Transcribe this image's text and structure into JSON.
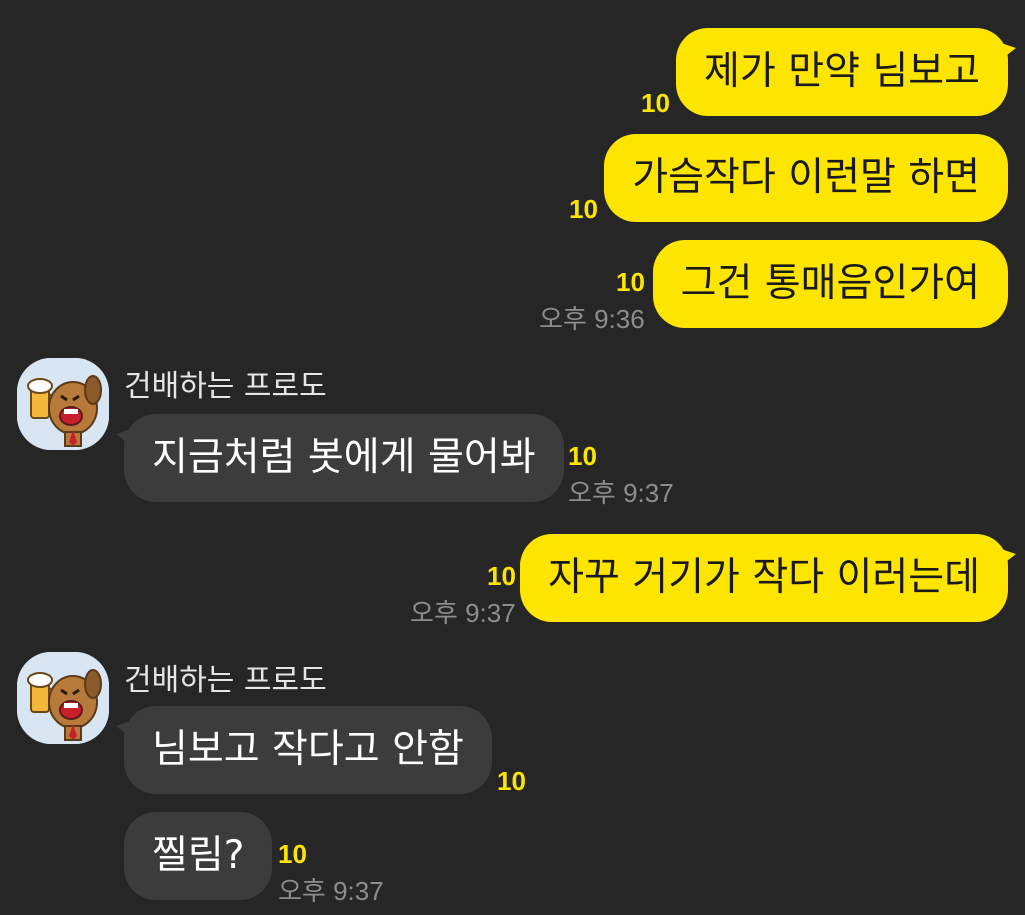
{
  "sender_name": "건배하는 프로도",
  "avatar_icon": "beer-toasting-dog-icon",
  "accent_color": "#fee500",
  "messages": [
    {
      "text": "제가 만약 님보고",
      "unread": "10"
    },
    {
      "text": "가슴작다 이런말 하면",
      "unread": "10"
    },
    {
      "text": "그건 통매음인가여",
      "unread": "10",
      "time": "오후 9:36"
    },
    {
      "text": "지금처럼 봇에게 물어봐",
      "unread": "10",
      "time": "오후 9:37"
    },
    {
      "text": "자꾸 거기가 작다 이러는데",
      "unread": "10",
      "time": "오후 9:37"
    },
    {
      "text": "님보고 작다고 안함",
      "unread": "10"
    },
    {
      "text": "찔림?",
      "unread": "10",
      "time": "오후 9:37"
    }
  ]
}
